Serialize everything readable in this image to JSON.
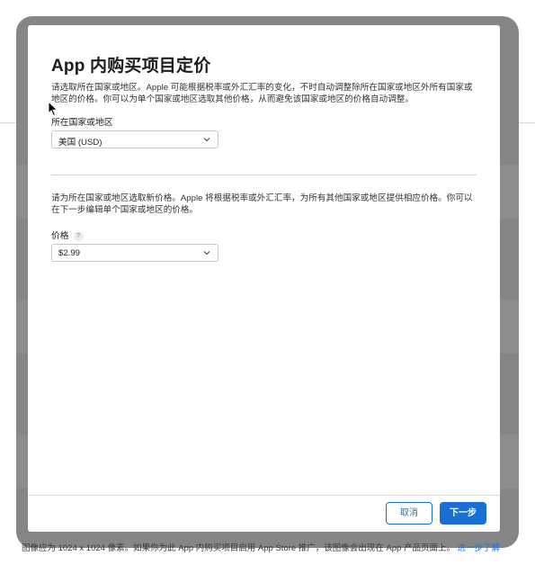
{
  "modal": {
    "title": "App 内购买项目定价",
    "intro_text": "请选取所在国家或地区。Apple 可能根据税率或外汇汇率的变化，不时自动调整除所在国家或地区外所有国家或地区的价格。你可以为单个国家或地区选取其他价格，从而避免该国家或地区的价格自动调整。",
    "country_field": {
      "label": "所在国家或地区",
      "value": "美国 (USD)"
    },
    "price_intro_text": "请为所在国家或地区选取新价格。Apple 将根据税率或外汇汇率，为所有其他国家或地区提供相应价格。你可以在下一步编辑单个国家或地区的价格。",
    "price_field": {
      "label": "价格",
      "help_glyph": "?",
      "value": "$2.99"
    },
    "buttons": {
      "cancel": "取消",
      "next": "下一步"
    }
  },
  "background": {
    "footer_text": "图像应为 1024 x 1024 像素。如果你为此 App 内购买项目启用 App Store 推广，该图像会出现在 App 产品页面上。",
    "footer_link": "进一步了解"
  },
  "colors": {
    "accent": "#1a6fd4",
    "overlay": "#868686"
  }
}
